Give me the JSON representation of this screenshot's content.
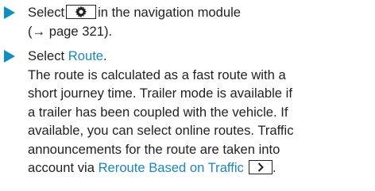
{
  "colors": {
    "bullet": "#0a8fc8",
    "link": "#1a86c5",
    "text": "#222222"
  },
  "steps": [
    {
      "icon": "play-arrow-icon",
      "select_prefix": "Select",
      "button_icon": "gear-icon",
      "line1_suffix": "in the navigation module",
      "line2": "(→ page 321)."
    },
    {
      "icon": "play-arrow-icon",
      "select_prefix": "Select",
      "link_route": "Route",
      "period": ".",
      "lines": [
        "The route is calculated as a fast route with a",
        "short journey time. Trailer mode is available if",
        "a trailer has been coupled with the vehicle. If",
        "available, you can select online routes. Traffic",
        "announcements for the route are taken into"
      ],
      "last_prefix": "account via",
      "link_reroute": "Reroute Based on Traffic",
      "button_icon": "chevron-right-icon"
    }
  ]
}
